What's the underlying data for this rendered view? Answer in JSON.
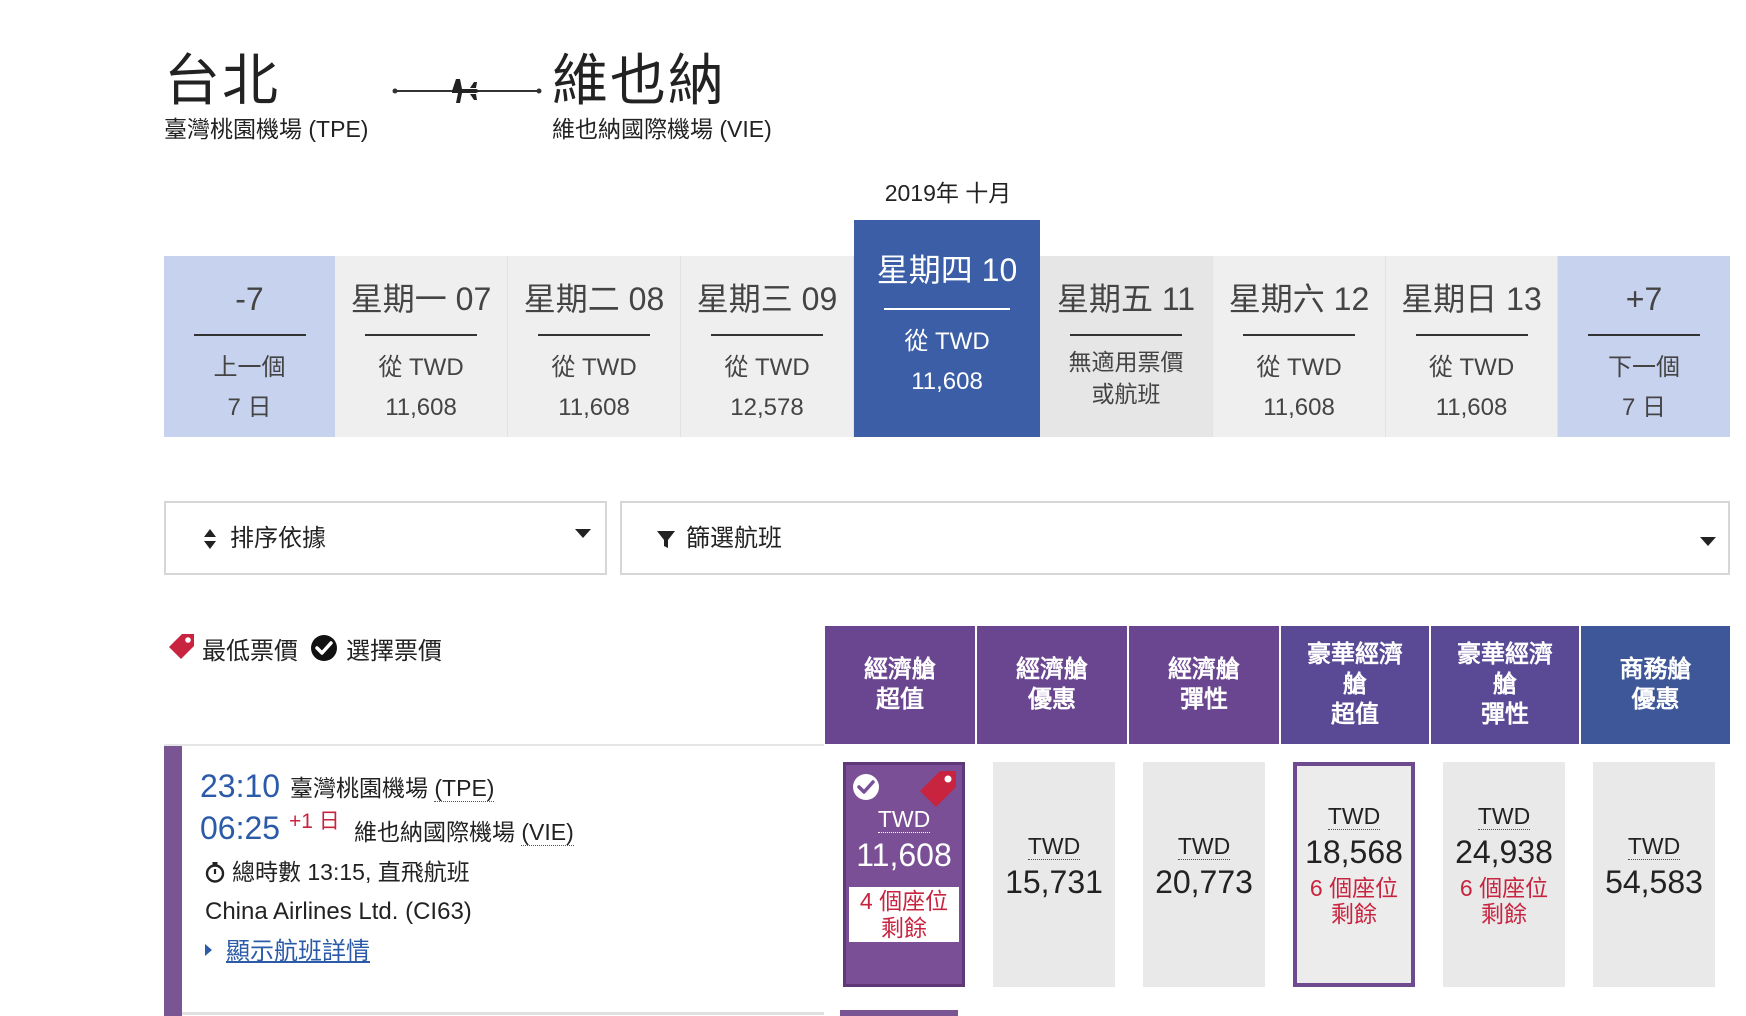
{
  "route": {
    "origin_city": "台北",
    "origin_airport": "臺灣桃園機場 (TPE)",
    "dest_city": "維也納",
    "dest_airport": "維也納國際機場 (VIE)",
    "arrow_icon": "plane-arrow-icon"
  },
  "month_label": "2019年 十月",
  "date_strip": {
    "prev": {
      "top": "-7",
      "line1": "上一個",
      "line2": "7 日"
    },
    "days": [
      {
        "label": "星期一 07",
        "line1": "從 TWD",
        "line2": "11,608",
        "state": "normal"
      },
      {
        "label": "星期二 08",
        "line1": "從 TWD",
        "line2": "11,608",
        "state": "normal"
      },
      {
        "label": "星期三 09",
        "line1": "從 TWD",
        "line2": "12,578",
        "state": "normal"
      },
      {
        "label": "星期四 10",
        "line1": "從 TWD",
        "line2": "11,608",
        "state": "active"
      },
      {
        "label": "星期五 11",
        "line1": "無適用票價",
        "line2": "或航班",
        "state": "unavailable"
      },
      {
        "label": "星期六 12",
        "line1": "從 TWD",
        "line2": "11,608",
        "state": "normal"
      },
      {
        "label": "星期日 13",
        "line1": "從 TWD",
        "line2": "11,608",
        "state": "normal"
      }
    ],
    "next": {
      "top": "+7",
      "line1": "下一個",
      "line2": "7 日"
    }
  },
  "sort": {
    "label": "排序依據",
    "icon": "sort-icon"
  },
  "filter": {
    "label": "篩選航班",
    "icon": "filter-icon"
  },
  "legend": {
    "lowest": "最低票價",
    "selected": "選擇票價"
  },
  "cabins": [
    {
      "line1": "經濟艙",
      "line2": "超值",
      "line3": "",
      "color": "#6b4690"
    },
    {
      "line1": "經濟艙",
      "line2": "優惠",
      "line3": "",
      "color": "#6b4690"
    },
    {
      "line1": "經濟艙",
      "line2": "彈性",
      "line3": "",
      "color": "#6b4690"
    },
    {
      "line1": "豪華經濟",
      "line2": "艙",
      "line3": "超值",
      "color": "#5a4a96"
    },
    {
      "line1": "豪華經濟",
      "line2": "艙",
      "line3": "彈性",
      "color": "#5a4a96"
    },
    {
      "line1": "商務艙",
      "line2": "優惠",
      "line3": "",
      "color": "#3e5799"
    }
  ],
  "flight": {
    "depart_time": "23:10",
    "depart_airport_name": "臺灣桃園機場",
    "depart_airport_code": "(TPE)",
    "arrive_time": "06:25",
    "day_offset": "+1 日",
    "arrive_airport_name": "維也納國際機場",
    "arrive_airport_code": "(VIE)",
    "duration": "總時數 13:15, 直飛航班",
    "airline": "China Airlines Ltd. (CI63)",
    "details_link": "顯示航班詳情"
  },
  "fares": [
    {
      "currency": "TWD",
      "price": "11,608",
      "seats": "4 個座位",
      "seats2": "剩餘",
      "style": "selected"
    },
    {
      "currency": "TWD",
      "price": "15,731",
      "seats": "",
      "seats2": "",
      "style": "plain"
    },
    {
      "currency": "TWD",
      "price": "20,773",
      "seats": "",
      "seats2": "",
      "style": "plain"
    },
    {
      "currency": "TWD",
      "price": "18,568",
      "seats": "6 個座位",
      "seats2": "剩餘",
      "style": "outlined"
    },
    {
      "currency": "TWD",
      "price": "24,938",
      "seats": "6 個座位",
      "seats2": "剩餘",
      "style": "seat"
    },
    {
      "currency": "TWD",
      "price": "54,583",
      "seats": "",
      "seats2": "",
      "style": "plain"
    }
  ]
}
